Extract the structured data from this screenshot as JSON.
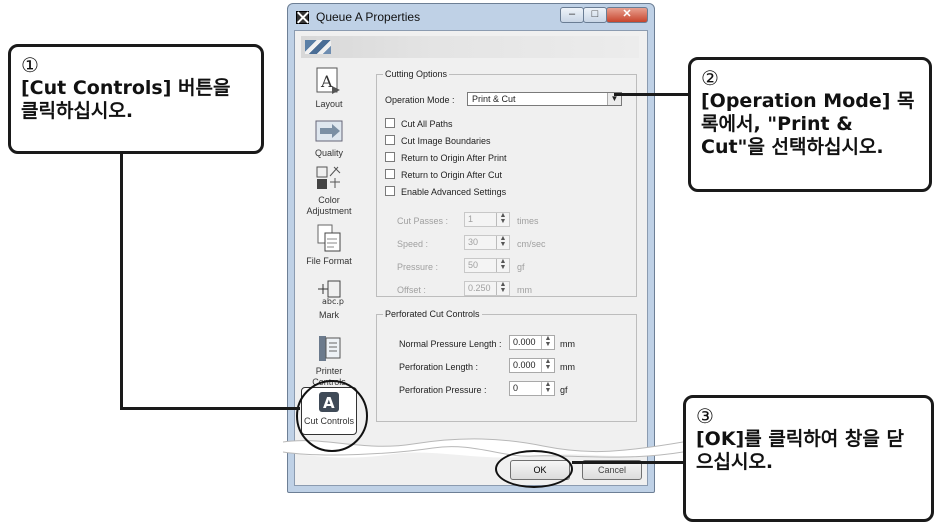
{
  "window": {
    "title": "Queue A Properties",
    "minimize": "–",
    "maximize": "□",
    "close": "✕"
  },
  "sidebar": {
    "items": [
      {
        "label": "Layout",
        "icon": "layout-icon"
      },
      {
        "label": "Quality",
        "icon": "quality-icon"
      },
      {
        "label": "Color Adjustment",
        "icon": "color-adjustment-icon"
      },
      {
        "label": "File Format",
        "icon": "file-format-icon"
      },
      {
        "label": "Mark",
        "icon": "mark-icon"
      },
      {
        "label": "Printer Controls",
        "icon": "printer-controls-icon"
      },
      {
        "label": "Cut Controls",
        "icon": "cut-controls-icon"
      }
    ]
  },
  "cutting_options": {
    "title": "Cutting Options",
    "operation_mode_label": "Operation Mode :",
    "operation_mode_value": "Print & Cut",
    "checkboxes": [
      "Cut All Paths",
      "Cut Image Boundaries",
      "Return to Origin After Print",
      "Return to Origin After Cut",
      "Enable Advanced Settings"
    ],
    "cut_passes_label": "Cut Passes :",
    "cut_passes_value": "1",
    "cut_passes_unit": "times",
    "speed_label": "Speed :",
    "speed_value": "30",
    "speed_unit": "cm/sec",
    "pressure_label": "Pressure :",
    "pressure_value": "50",
    "pressure_unit": "gf",
    "offset_label": "Offset :",
    "offset_value": "0.250",
    "offset_unit": "mm"
  },
  "perforated": {
    "title": "Perforated Cut Controls",
    "normal_label": "Normal Pressure Length :",
    "normal_value": "0.000",
    "normal_unit": "mm",
    "perf_length_label": "Perforation Length :",
    "perf_length_value": "0.000",
    "perf_length_unit": "mm",
    "perf_pressure_label": "Perforation Pressure :",
    "perf_pressure_value": "0",
    "perf_pressure_unit": "gf"
  },
  "buttons": {
    "ok": "OK",
    "cancel": "Cancel"
  },
  "callouts": {
    "step1": {
      "num": "①",
      "text": "[Cut Controls] 버튼을 클릭하십시오."
    },
    "step2": {
      "num": "②",
      "text": "[Operation Mode] 목록에서, \"Print & Cut\"을 선택하십시오."
    },
    "step3": {
      "num": "③",
      "text": "[OK]를 클릭하여 창을 닫으십시오."
    }
  }
}
